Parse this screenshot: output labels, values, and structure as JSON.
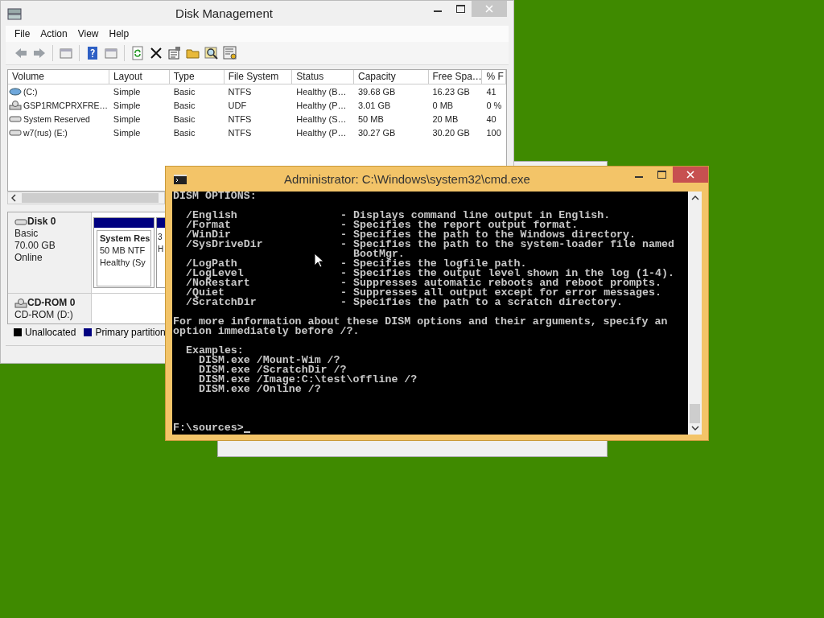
{
  "disk_management": {
    "title": "Disk Management",
    "menu": [
      "File",
      "Action",
      "View",
      "Help"
    ],
    "table": {
      "columns": [
        "Volume",
        "Layout",
        "Type",
        "File System",
        "Status",
        "Capacity",
        "Free Spa…",
        "% F"
      ],
      "rows": [
        {
          "kind": "disk",
          "cells": [
            "(C:)",
            "Simple",
            "Basic",
            "NTFS",
            "Healthy (B…",
            "39.68 GB",
            "16.23 GB",
            "41"
          ]
        },
        {
          "kind": "optical",
          "cells": [
            "GSP1RMCPRXFRE…",
            "Simple",
            "Basic",
            "UDF",
            "Healthy (P…",
            "3.01 GB",
            "0 MB",
            "0 %"
          ]
        },
        {
          "kind": "drive",
          "cells": [
            "System Reserved",
            "Simple",
            "Basic",
            "NTFS",
            "Healthy (S…",
            "50 MB",
            "20 MB",
            "40"
          ]
        },
        {
          "kind": "drive",
          "cells": [
            "w7(rus) (E:)",
            "Simple",
            "Basic",
            "NTFS",
            "Healthy (P…",
            "30.27 GB",
            "30.20 GB",
            "100"
          ]
        }
      ]
    },
    "disks": [
      {
        "kind": "disk",
        "name": "Disk 0",
        "details": [
          "Basic",
          "70.00 GB",
          "Online"
        ],
        "partitions": [
          {
            "lines": [
              "System Res",
              "50 MB NTF",
              "Healthy (Sy"
            ]
          },
          {
            "lines": [
              "3",
              "H"
            ]
          }
        ]
      },
      {
        "kind": "optical",
        "name": "CD-ROM 0",
        "details": [
          "CD-ROM (D:)"
        ]
      }
    ],
    "legend": [
      {
        "label": "Unallocated",
        "color": "#000000"
      },
      {
        "label": "Primary partition",
        "color": "#000080"
      }
    ]
  },
  "cmd": {
    "title": "Administrator: C:\\Windows\\system32\\cmd.exe",
    "heading": "DISM OPTIONS:",
    "options": [
      {
        "name": "/English",
        "description": "- Displays command line output in English."
      },
      {
        "name": "/Format",
        "description": "- Specifies the report output format."
      },
      {
        "name": "/WinDir",
        "description": "- Specifies the path to the Windows directory."
      },
      {
        "name": "/SysDriveDir",
        "description": "- Specifies the path to the system-loader file named",
        "continuation": "BootMgr."
      },
      {
        "name": "/LogPath",
        "description": "- Specifies the logfile path."
      },
      {
        "name": "/LogLevel",
        "description": "- Specifies the output level shown in the log (1-4)."
      },
      {
        "name": "/NoRestart",
        "description": "- Suppresses automatic reboots and reboot prompts."
      },
      {
        "name": "/Quiet",
        "description": "- Suppresses all output except for error messages."
      },
      {
        "name": "/ScratchDir",
        "description": "- Specifies the path to a scratch directory."
      }
    ],
    "more_info": [
      "For more information about these DISM options and their arguments, specify an",
      "option immediately before /?."
    ],
    "examples_label": "Examples:",
    "examples": [
      "DISM.exe /Mount-Wim /?",
      "DISM.exe /ScratchDir /?",
      "DISM.exe /Image:C:\\test\\offline /?",
      "DISM.exe /Online /?"
    ],
    "prompt": "F:\\sources>"
  }
}
